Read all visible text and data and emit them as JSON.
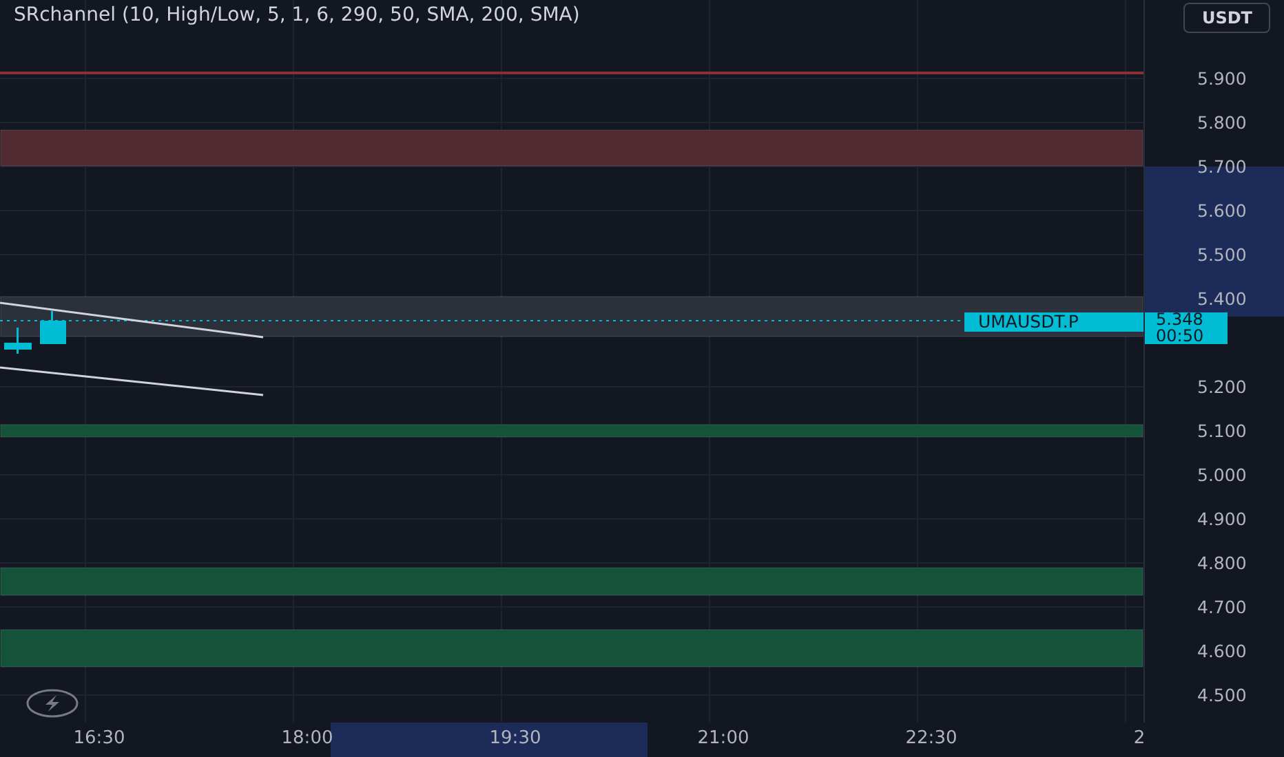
{
  "legend": {
    "title": "SRchannel (10, High/Low, 5, 1, 6, 290, 50, SMA, 200, SMA)"
  },
  "currency_button": {
    "label": "USDT"
  },
  "zones": [
    {
      "kind": "line",
      "color": "#8a2f33"
    },
    {
      "kind": "band",
      "color": "#4f2a31"
    },
    {
      "kind": "band",
      "color": "#2c303b"
    },
    {
      "kind": "band",
      "color": "#145239"
    },
    {
      "kind": "band",
      "color": "#145239"
    },
    {
      "kind": "band",
      "color": "#145239"
    }
  ],
  "price_axis": {
    "labels": [
      "5.900",
      "5.800",
      "5.700",
      "5.600",
      "5.500",
      "5.400",
      "5.200",
      "5.100",
      "5.000",
      "4.900",
      "4.800",
      "4.700",
      "4.600",
      "4.500"
    ]
  },
  "last_price": {
    "symbol": "UMAUSDT.P",
    "price": "5.348",
    "countdown": "00:50"
  },
  "time_axis": {
    "labels": [
      "16:30",
      "18:00",
      "19:30",
      "21:00",
      "22:30",
      "2"
    ]
  }
}
